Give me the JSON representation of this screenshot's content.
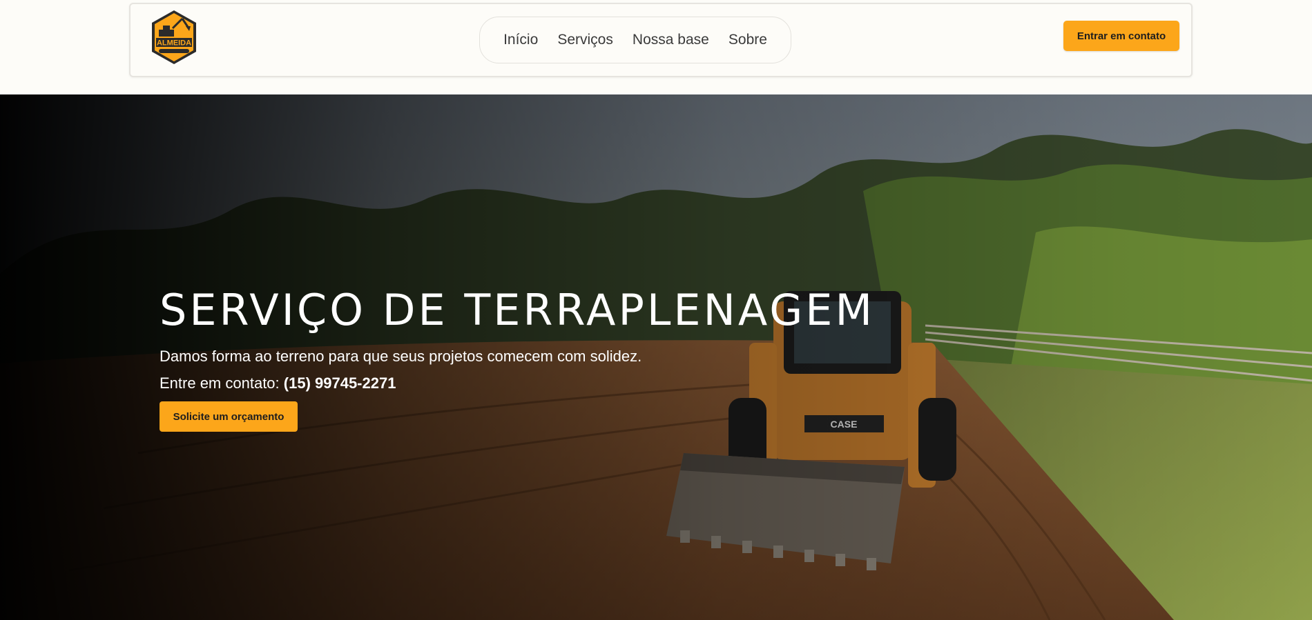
{
  "brand": {
    "logo_text": "ALMEIDA",
    "logo_icon": "excavator-icon",
    "accent_color": "#fca61a",
    "logo_dark": "#2b2b2b"
  },
  "nav": {
    "items": [
      {
        "label": "Início"
      },
      {
        "label": "Serviços"
      },
      {
        "label": "Nossa base"
      },
      {
        "label": "Sobre"
      }
    ]
  },
  "header": {
    "contact_button": "Entrar em contato"
  },
  "hero": {
    "title": "SERVIÇO DE TERRAPLENAGEM",
    "subtitle": "Damos forma ao terreno para que seus projetos comecem com solidez.",
    "contact_prefix": "Entre em contato:",
    "phone": "(15) 99745-2271",
    "cta_label": "Solicite um orçamento",
    "image_description_icon": "skid-steer-loader-photo"
  }
}
